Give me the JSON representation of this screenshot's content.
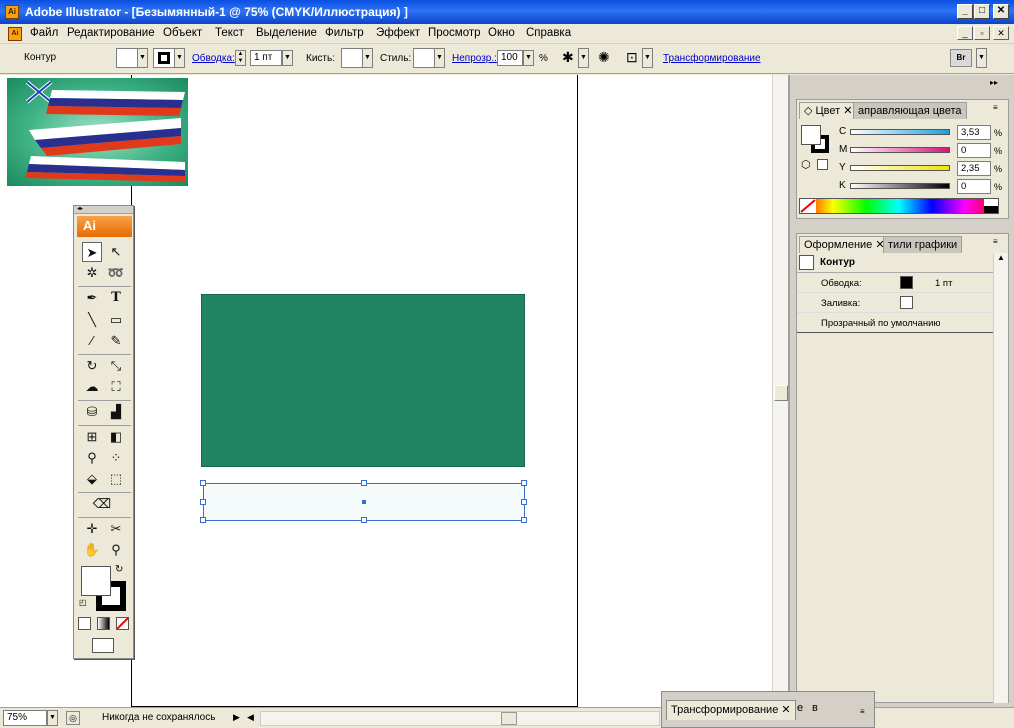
{
  "window": {
    "title": "Adobe Illustrator - [Безымянный-1 @ 75% (CMYK/Иллюстрация) ]",
    "app_icon": "Ai",
    "minimize": "_",
    "maximize": "□",
    "close": "✕"
  },
  "menu": {
    "items": [
      "Файл",
      "Редактирование",
      "Объект",
      "Текст",
      "Выделение",
      "Фильтр",
      "Эффект",
      "Просмотр",
      "Окно",
      "Справка"
    ]
  },
  "control_bar": {
    "selection_label": "Контур",
    "stroke_link": "Обводка:",
    "stroke_value": "1 пт",
    "brush_label": "Кисть:",
    "style_label": "Стиль:",
    "opacity_link": "Непрозр.:",
    "opacity_value": "100",
    "opacity_unit": "%",
    "transform_link": "Трансформирование",
    "bridge_label": "Br"
  },
  "color_panel": {
    "tab_color": "Цвет",
    "tab_guide": "аправляющая цвета",
    "channels": [
      {
        "label": "C",
        "value": "3,53",
        "color": "#1aa0d8"
      },
      {
        "label": "M",
        "value": "0",
        "color": "#d8127c"
      },
      {
        "label": "Y",
        "value": "2,35",
        "color": "#f1e400"
      },
      {
        "label": "K",
        "value": "0",
        "color": "#000000"
      }
    ],
    "unit": "%"
  },
  "appearance_panel": {
    "tab_appearance": "Оформление",
    "tab_styles": "тили графики",
    "object_label": "Контур",
    "stroke_label": "Обводка:",
    "stroke_value": "1 пт",
    "fill_label": "Заливка:",
    "opacity_row": "Прозрачный по умолчанию"
  },
  "tool_palette": {
    "logo": "Ai"
  },
  "transform_panel": {
    "tab": "Трансформирование",
    "tab2": "е",
    "tab3": "в"
  },
  "status_bar": {
    "zoom": "75%",
    "status_text": "Никогда не сохранялось"
  },
  "colors": {
    "green_rect": "#228462",
    "selection": "#3a6ad8"
  }
}
